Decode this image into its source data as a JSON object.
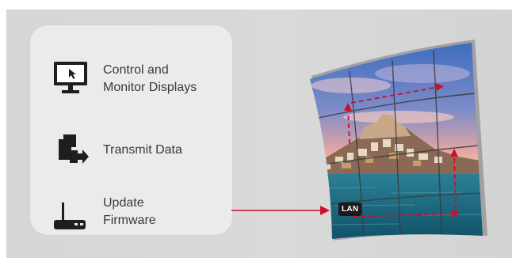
{
  "features": [
    {
      "label": "Control and\nMonitor Displays",
      "icon": "monitor-cursor-icon"
    },
    {
      "label": "Transmit Data",
      "icon": "file-transfer-icon"
    },
    {
      "label": "Update\nFirmware",
      "icon": "router-icon"
    }
  ],
  "lan_badge": "LAN",
  "colors": {
    "accent_red": "#c8102e",
    "panel": "#ebebeb",
    "background": "#d8d8d8",
    "icon": "#1e1e1e"
  },
  "video_wall": {
    "image": "curved-video-wall-coastal-town",
    "grid_columns": 4,
    "grid_rows": 4
  }
}
